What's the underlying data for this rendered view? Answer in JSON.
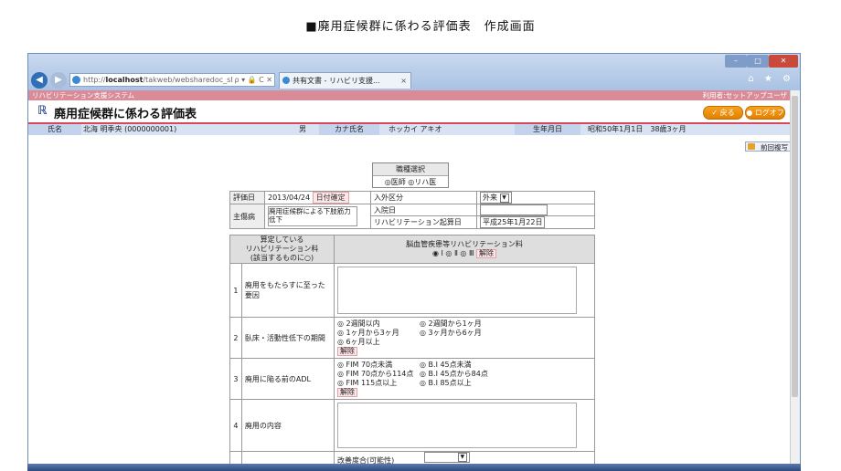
{
  "caption": "■廃用症候群に係わる評価表　作成画面",
  "browser": {
    "window_min": "–",
    "window_max": "□",
    "window_close": "✕",
    "back_icon": "◀",
    "forward_icon": "▶",
    "address_prefix": "http://",
    "address_host": "localhost",
    "address_path": "/takweb/websharedoc_shee",
    "address_buttons": "ρ ▾ 🔒 C ✕",
    "tab_label": "共有文書 - リハビリ支援...",
    "tab_close": "×",
    "toolbar_icons": "⌂ ★ ⚙"
  },
  "sysbar": {
    "system_name": "リハビリテーション支援システム",
    "user": "利用者:セットアップユーザ"
  },
  "header": {
    "title": "廃用症候群に係わる評価表",
    "back_label": "戻る",
    "logout_label": "ログオフ"
  },
  "patient": {
    "name_label": "氏名",
    "name_value": "北海 明季央 (0000000001)",
    "sex_value": "男",
    "kana_label": "カナ氏名",
    "kana_value": "ホッカイ アキオ",
    "birth_label": "生年月日",
    "birth_value": "昭和50年1月1日　38歳3ヶ月"
  },
  "prev_copy_label": "前回複写",
  "shokushu": {
    "title": "職種選択",
    "opt1": "医師",
    "opt2": "リハ医"
  },
  "form": {
    "hyoka_label": "評価日",
    "hyoka_value": "2013/04/24",
    "kakutei_label": "日付確定",
    "nyugai_label": "入外区分",
    "nyugai_value": "外来",
    "nyuin_label": "入院日",
    "shobyo_label": "主傷病",
    "shobyo_value": "廃用症候群による下肢筋力低下",
    "kisan_label": "リハビリテーション起算日",
    "kisan_value": "平成25年1月22日"
  },
  "eval": {
    "left_header": "算定している\nリハビリテーション料\n(該当するものに○)",
    "right_header": "脳血管疾患等リハビリテーション料",
    "roman1": "Ⅰ",
    "roman2": "Ⅱ",
    "roman3": "Ⅲ",
    "kaijo": "解除",
    "q1_num": "1",
    "q1": "廃用をもたらすに至った要因",
    "q2_num": "2",
    "q2": "臥床・活動性低下の期間",
    "q2_opts": [
      "2週間以内",
      "2週間から1ヶ月",
      "1ヶ月から3ヶ月",
      "3ヶ月から6ヶ月",
      "6ヶ月以上"
    ],
    "q3_num": "3",
    "q3": "廃用に陥る前のADL",
    "q3_opts": [
      "FIM 70点未満",
      "B.I 45点未満",
      "FIM 70点から114点",
      "B.I 45点から84点",
      "FIM 115点以上",
      "B.I 85点以上"
    ],
    "q4_num": "4",
    "q4": "廃用の内容",
    "q5_label": "改善度合(可能性)"
  }
}
